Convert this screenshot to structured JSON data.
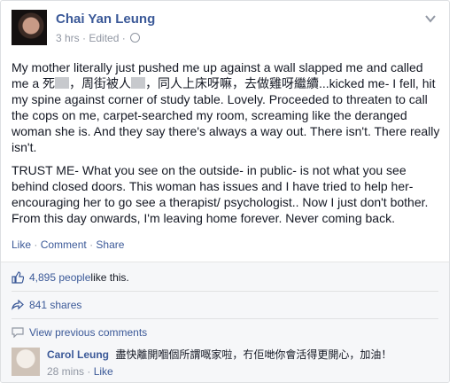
{
  "post": {
    "author": "Chai Yan Leung",
    "time": "3 hrs",
    "edited": "Edited",
    "separator": "·",
    "paragraph1_a": "My mother literally just pushed me up against a wall slapped me and called me a 死",
    "paragraph1_b": "，周街被人",
    "paragraph1_c": "，同人上床呀嘛，去做雞呀繼續...kicked me- I fell, hit my spine against corner of study table. Lovely. Proceeded to threaten to call the cops on me, carpet-searched my room, screaming like the deranged woman she is. And they say there's always a way out. There isn't. There really isn't.",
    "paragraph2": "TRUST ME- What you see on the outside- in public- is not what you see behind closed doors. This woman has issues and I have tried to help her- encouraging her to go see a therapist/ psychologist.. Now I just don't bother. From this day onwards, I'm leaving home forever. Never coming back."
  },
  "actions": {
    "like": "Like",
    "comment": "Comment",
    "share": "Share",
    "dot": "·"
  },
  "ufi": {
    "likes_count": "4,895 people",
    "likes_suffix": " like this.",
    "shares": "841 shares",
    "view_previous": "View previous comments"
  },
  "comment": {
    "name": "Carol Leung",
    "text": "盡快離開嗰個所謂嘅家啦，冇佢哋你會活得更開心，加油！",
    "time": "28 mins",
    "like": "Like",
    "dot": "·"
  },
  "colors": {
    "link": "#3b5998",
    "meta": "#9197a3",
    "ufi_bg": "#f6f7f9"
  }
}
